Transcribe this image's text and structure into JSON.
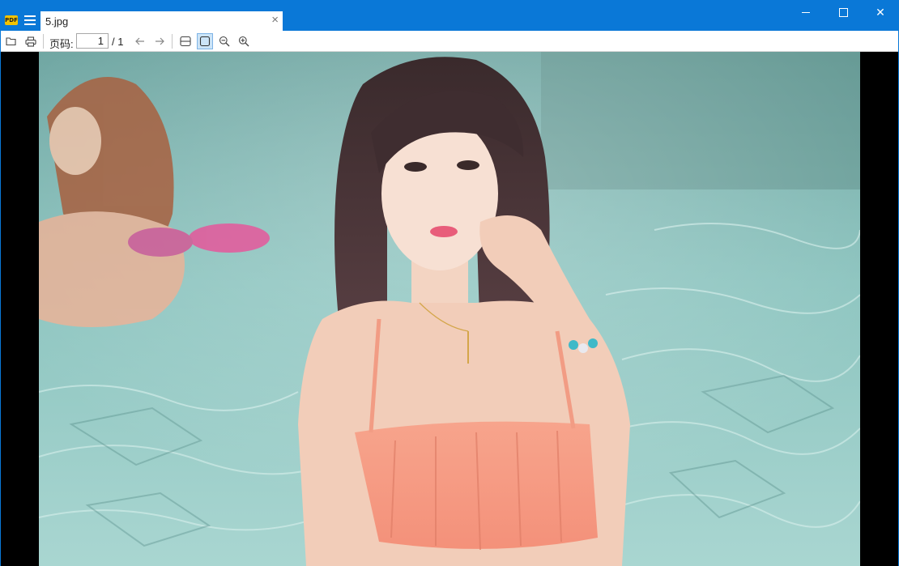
{
  "titlebar": {
    "tab_label": "5.jpg",
    "tab_close_glyph": "×",
    "logo_text": "PDF",
    "minimize_icon": "minimize-icon",
    "maximize_icon": "maximize-icon",
    "close_glyph": "✕",
    "accent_color": "#0a78d7"
  },
  "toolbar": {
    "page_label": "页码:",
    "page_value": "1",
    "page_total": "/ 1",
    "icons": [
      "folder-open-icon",
      "print-icon",
      "arrow-left-icon",
      "arrow-right-icon",
      "fit-width-icon",
      "fit-page-icon",
      "zoom-out-icon",
      "zoom-in-icon"
    ]
  }
}
